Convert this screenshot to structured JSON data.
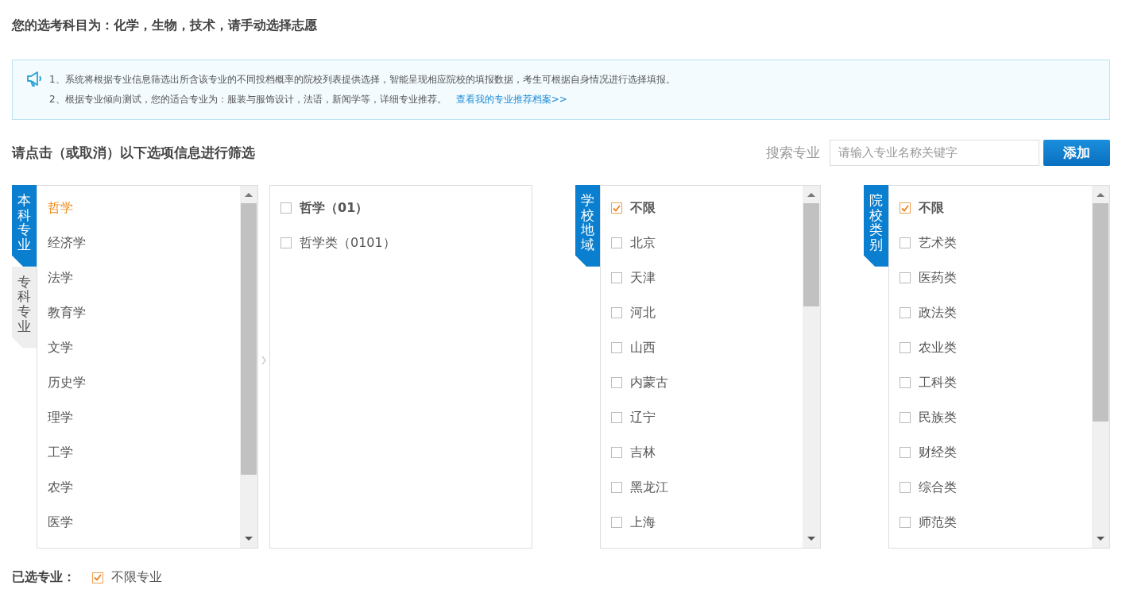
{
  "header": {
    "title": "您的选考科目为：化学，生物，技术，请手动选择志愿"
  },
  "notice": {
    "lines": [
      "1、系统将根据专业信息筛选出所含该专业的不同投档概率的院校列表提供选择，智能呈现相应院校的填报数据，考生可根据自身情况进行选择填报。",
      "2、根据专业倾向测试，您的适合专业为：服装与服饰设计，法语，新闻学等，详细专业推荐。"
    ],
    "link": "查看我的专业推荐档案>>"
  },
  "filter": {
    "title": "请点击（或取消）以下选项信息进行筛选",
    "search_label": "搜索专业",
    "search_placeholder": "请输入专业名称关键字",
    "add_button": "添加"
  },
  "major_tabs": [
    {
      "label": "本科专业",
      "selected": true
    },
    {
      "label": "专科专业",
      "selected": false
    }
  ],
  "categories": [
    {
      "label": "哲学",
      "selected": true
    },
    {
      "label": "经济学",
      "selected": false
    },
    {
      "label": "法学",
      "selected": false
    },
    {
      "label": "教育学",
      "selected": false
    },
    {
      "label": "文学",
      "selected": false
    },
    {
      "label": "历史学",
      "selected": false
    },
    {
      "label": "理学",
      "selected": false
    },
    {
      "label": "工学",
      "selected": false
    },
    {
      "label": "农学",
      "selected": false
    },
    {
      "label": "医学",
      "selected": false
    }
  ],
  "subjects": [
    {
      "label": "哲学（01）",
      "checked": false,
      "kind": "group"
    },
    {
      "label": "哲学类（0101）",
      "checked": false,
      "kind": "item"
    }
  ],
  "region": {
    "tab": "学校地域",
    "options": [
      {
        "label": "不限",
        "checked": true,
        "kind": "any"
      },
      {
        "label": "北京",
        "checked": false,
        "kind": "option"
      },
      {
        "label": "天津",
        "checked": false,
        "kind": "option"
      },
      {
        "label": "河北",
        "checked": false,
        "kind": "option"
      },
      {
        "label": "山西",
        "checked": false,
        "kind": "option"
      },
      {
        "label": "内蒙古",
        "checked": false,
        "kind": "option"
      },
      {
        "label": "辽宁",
        "checked": false,
        "kind": "option"
      },
      {
        "label": "吉林",
        "checked": false,
        "kind": "option"
      },
      {
        "label": "黑龙江",
        "checked": false,
        "kind": "option"
      },
      {
        "label": "上海",
        "checked": false,
        "kind": "option"
      }
    ]
  },
  "school_type": {
    "tab": "院校类别",
    "options": [
      {
        "label": "不限",
        "checked": true,
        "kind": "any"
      },
      {
        "label": "艺术类",
        "checked": false,
        "kind": "option"
      },
      {
        "label": "医药类",
        "checked": false,
        "kind": "option"
      },
      {
        "label": "政法类",
        "checked": false,
        "kind": "option"
      },
      {
        "label": "农业类",
        "checked": false,
        "kind": "option"
      },
      {
        "label": "工科类",
        "checked": false,
        "kind": "option"
      },
      {
        "label": "民族类",
        "checked": false,
        "kind": "option"
      },
      {
        "label": "财经类",
        "checked": false,
        "kind": "option"
      },
      {
        "label": "综合类",
        "checked": false,
        "kind": "option"
      },
      {
        "label": "师范类",
        "checked": false,
        "kind": "option"
      }
    ]
  },
  "chosen": {
    "label": "已选专业：",
    "items": [
      {
        "label": "不限专业",
        "checked": true
      }
    ]
  }
}
